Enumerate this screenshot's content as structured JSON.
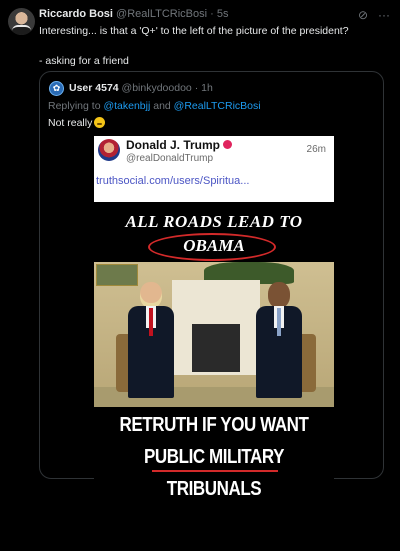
{
  "tweet": {
    "author_name": "Riccardo Bosi",
    "author_handle": "@RealLTCRicBosi",
    "time": "· 5s",
    "text_line1": "Interesting... is that a 'Q+' to the left of the picture of the president?",
    "text_line2": "- asking for a friend"
  },
  "quoted_tweet": {
    "author_name": "User 4574",
    "author_handle": "@binkydoodoo",
    "time": "· 1h",
    "reply_prefix": "Replying to ",
    "reply_to_1": "@takenbjj",
    "reply_and": " and ",
    "reply_to_2": "@RealLTCRicBosi",
    "text": "Not really"
  },
  "embedded_post": {
    "name": "Donald J. Trump",
    "handle": "@realDonaldTrump",
    "time": "26m",
    "link": "truthsocial.com/users/Spiritua...",
    "caption_top": "ALL ROADS LEAD TO",
    "caption_circled": "OBAMA",
    "caption_bottom_1": "RETRUTH IF YOU WANT",
    "caption_bottom_2": "PUBLIC MILITARY",
    "caption_bottom_3": "TRIBUNALS"
  },
  "icons": [
    "avatar",
    "grok-icon",
    "more-icon",
    "smiley-emoji",
    "verified-badge"
  ],
  "colors": {
    "background": "#000000",
    "link": "#1d9bf0",
    "accent_red": "#d32a2a"
  }
}
